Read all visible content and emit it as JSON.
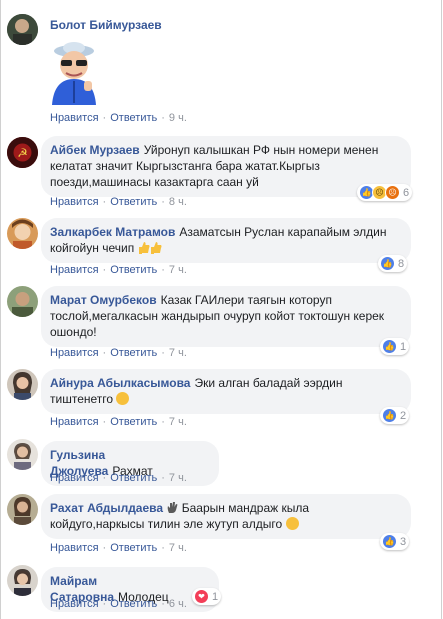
{
  "comments": [
    {
      "author": "Болот Биймурзаев",
      "text": "",
      "like": "Нравится",
      "reply": "Ответить",
      "time": "9 ч."
    },
    {
      "author": "Айбек Мурзаев",
      "text": "Уйронуп калышкан РФ нын номери менен келатат значит Кыргызстанга бара жатат.Кыргыз поезди,машинасы казактарга саан уй",
      "like": "Нравится",
      "reply": "Ответить",
      "time": "8 ч.",
      "reactions": {
        "icons": [
          "like-icon",
          "sad-icon",
          "angry-icon"
        ],
        "count": "6"
      }
    },
    {
      "author": "Залкарбек Матрамов",
      "text": "Азаматсын Руслан карапайым элдин койгойун чечип",
      "like": "Нравится",
      "reply": "Ответить",
      "time": "7 ч.",
      "reactions": {
        "icons": [
          "like-icon"
        ],
        "count": "8"
      }
    },
    {
      "author": "Марат Омурбеков",
      "text": "Казак ГАИлери таягын которуп тослой,мегалкасын жандырып очуруп койот токтошун керек ошондо!",
      "like": "Нравится",
      "reply": "Ответить",
      "time": "7 ч.",
      "reactions": {
        "icons": [
          "like-icon"
        ],
        "count": "1"
      }
    },
    {
      "author": "Айнура Абылкасымова",
      "text": "Эки алган баладай ээрдин тиштенетго",
      "like": "Нравится",
      "reply": "Ответить",
      "time": "7 ч.",
      "reactions": {
        "icons": [
          "like-icon"
        ],
        "count": "2"
      }
    },
    {
      "author": "Гульзина Джолуева",
      "text": "Рахмат",
      "like": "Нравится",
      "reply": "Ответить",
      "time": "7 ч."
    },
    {
      "author": "Рахат Абдылдаева",
      "text": "Баарын мандраж кыла койдуго,наркысы тилин эле жутуп алдыго",
      "like": "Нравится",
      "reply": "Ответить",
      "time": "7 ч.",
      "reactions": {
        "icons": [
          "like-icon"
        ],
        "count": "3"
      }
    },
    {
      "author": "Майрам Сатаровна",
      "text": "Молодец",
      "like": "Нравится",
      "reply": "Ответить",
      "time": "6 ч.",
      "reactions": {
        "icons": [
          "love-icon"
        ],
        "count": "1"
      }
    }
  ],
  "colors": {
    "link": "#385898",
    "bubble": "#f2f3f5",
    "meta": "#90949c",
    "like": "#4e7fe8",
    "love": "#f33e58"
  }
}
